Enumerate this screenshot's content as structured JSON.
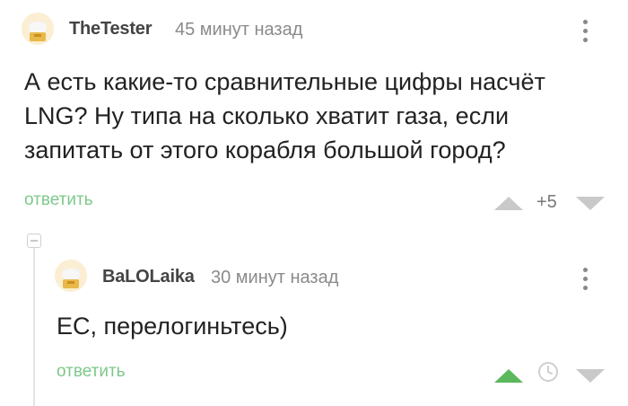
{
  "comment": {
    "author": "TheTester",
    "time": "45 минут назад",
    "text_lines": [
      "А есть какие-то сравнительные цифры насчёт",
      "LNG? Ну типа на сколько хватит газа, если",
      "запитать от этого корабля большой город?"
    ],
    "reply_label": "ответить",
    "score": "+5",
    "avatar_icon": "cat-avatar-icon",
    "menu_icon": "more-vertical-icon"
  },
  "reply_comment": {
    "author": "BaLOLaika",
    "time": "30 минут назад",
    "text": "ЕС, перелогиньтесь)",
    "reply_label": "ответить",
    "avatar_icon": "cat-avatar-icon",
    "menu_icon": "more-vertical-icon"
  },
  "colors": {
    "accent_green": "#5cb85c",
    "reply_link": "#7ec88a",
    "vote_gray": "#c9c9c9"
  }
}
